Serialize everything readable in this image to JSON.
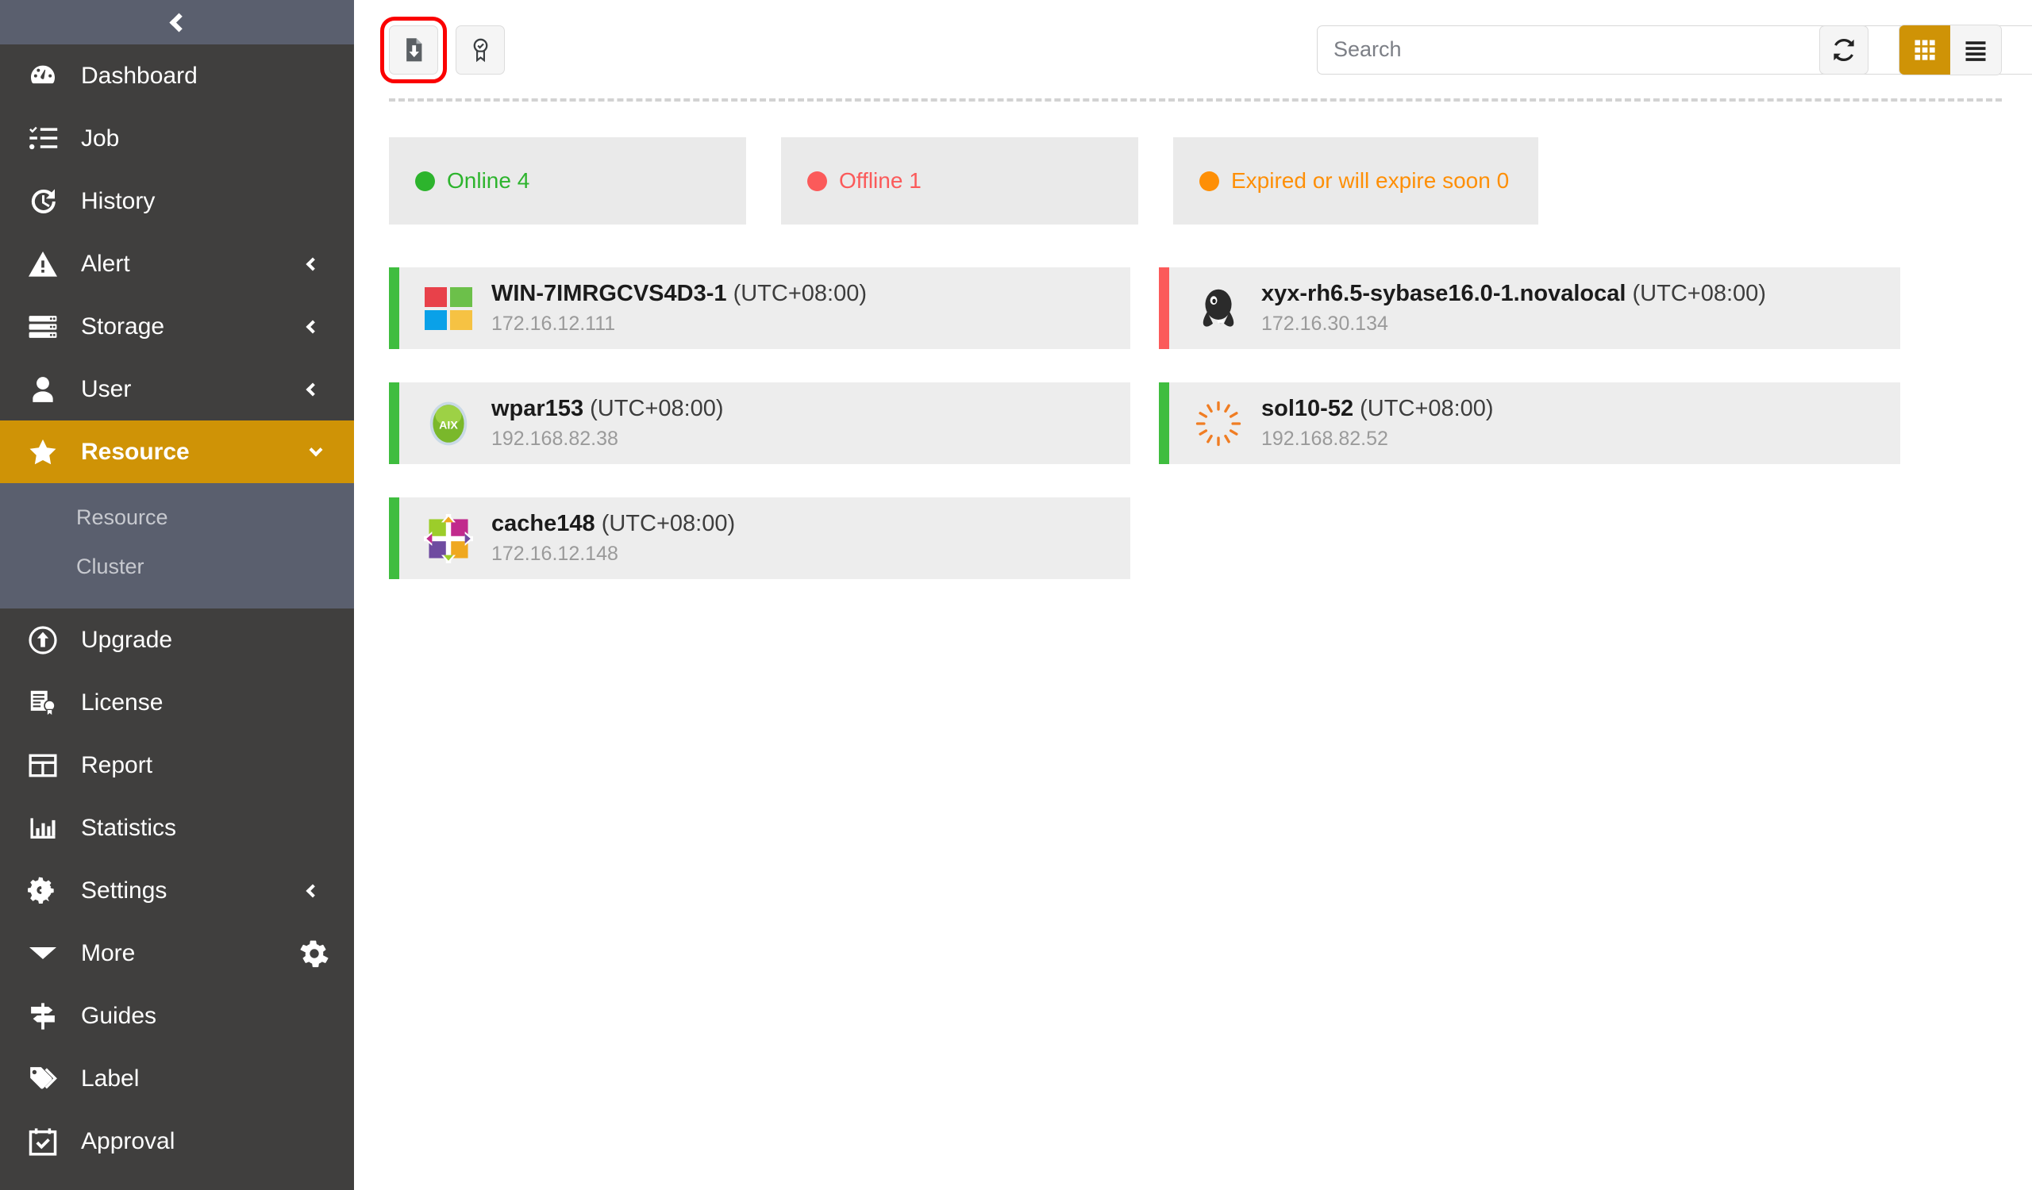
{
  "sidebar": {
    "collapse_icon": "chevron-left-icon",
    "items": [
      {
        "label": "Dashboard",
        "icon": "dashboard-gauge-icon",
        "state": "normal"
      },
      {
        "label": "Job",
        "icon": "job-checklist-icon",
        "state": "normal"
      },
      {
        "label": "History",
        "icon": "history-clock-icon",
        "state": "normal"
      },
      {
        "label": "Alert",
        "icon": "alert-triangle-icon",
        "state": "normal",
        "expandable": true
      },
      {
        "label": "Storage",
        "icon": "storage-server-icon",
        "state": "normal",
        "expandable": true
      },
      {
        "label": "User",
        "icon": "user-person-icon",
        "state": "normal",
        "expandable": true
      },
      {
        "label": "Resource",
        "icon": "star-icon",
        "state": "active",
        "expandable": true,
        "expanded": true
      },
      {
        "label": "Upgrade",
        "icon": "upgrade-arrow-up-circle-icon",
        "state": "normal"
      },
      {
        "label": "License",
        "icon": "license-certificate-icon",
        "state": "normal"
      },
      {
        "label": "Report",
        "icon": "report-table-icon",
        "state": "normal"
      },
      {
        "label": "Statistics",
        "icon": "statistics-bar-chart-icon",
        "state": "normal"
      },
      {
        "label": "Settings",
        "icon": "settings-gears-icon",
        "state": "normal",
        "expandable": true
      },
      {
        "label": "More",
        "icon": "caret-down-icon",
        "state": "normal",
        "trailing_icon": "gear-icon"
      },
      {
        "label": "Guides",
        "icon": "guides-signpost-icon",
        "state": "normal"
      },
      {
        "label": "Label",
        "icon": "label-tag-icon",
        "state": "normal"
      },
      {
        "label": "Approval",
        "icon": "approval-calendar-check-icon",
        "state": "normal"
      }
    ],
    "submenu": [
      {
        "label": "Resource"
      },
      {
        "label": "Cluster"
      }
    ],
    "colors": {
      "background": "#403f3e",
      "active": "#cf9306",
      "submenu_bg": "#5a5f6e",
      "header_bg": "#5a5f6e"
    }
  },
  "toolbar": {
    "buttons": [
      {
        "name": "install-agent-button",
        "icon": "file-download-icon",
        "highlighted": true
      },
      {
        "name": "certificate-button",
        "icon": "certificate-badge-icon",
        "highlighted": false
      }
    ],
    "search": {
      "value": "",
      "placeholder": "Search"
    },
    "refresh": {
      "name": "refresh-button",
      "icon": "refresh-icon"
    },
    "views": [
      {
        "name": "grid-view-button",
        "icon": "grid-icon",
        "active": true
      },
      {
        "name": "list-view-button",
        "icon": "list-icon",
        "active": false
      }
    ]
  },
  "status_cards": [
    {
      "label": "Online",
      "count": "4",
      "color": "#2db42d"
    },
    {
      "label": "Offline",
      "count": "1",
      "color": "#fb5a5a"
    },
    {
      "label": "Expired or will expire soon",
      "count": "0",
      "color": "#fe8f06"
    }
  ],
  "resources": [
    {
      "name": "WIN-7IMRGCVS4D3-1",
      "timezone": "(UTC+08:00)",
      "ip": "172.16.12.111",
      "os": "windows",
      "status": "online",
      "status_color": "#3fbd3f"
    },
    {
      "name": "xyx-rh6.5-sybase16.0-1.novalocal",
      "timezone": "(UTC+08:00)",
      "ip": "172.16.30.134",
      "os": "linux",
      "status": "offline",
      "status_color": "#fb5a5a"
    },
    {
      "name": "wpar153",
      "timezone": "(UTC+08:00)",
      "ip": "192.168.82.38",
      "os": "aix",
      "status": "online",
      "status_color": "#3fbd3f"
    },
    {
      "name": "sol10-52",
      "timezone": "(UTC+08:00)",
      "ip": "192.168.82.52",
      "os": "solaris",
      "status": "online",
      "status_color": "#3fbd3f"
    },
    {
      "name": "cache148",
      "timezone": "(UTC+08:00)",
      "ip": "172.16.12.148",
      "os": "centos",
      "status": "online",
      "status_color": "#3fbd3f"
    }
  ]
}
